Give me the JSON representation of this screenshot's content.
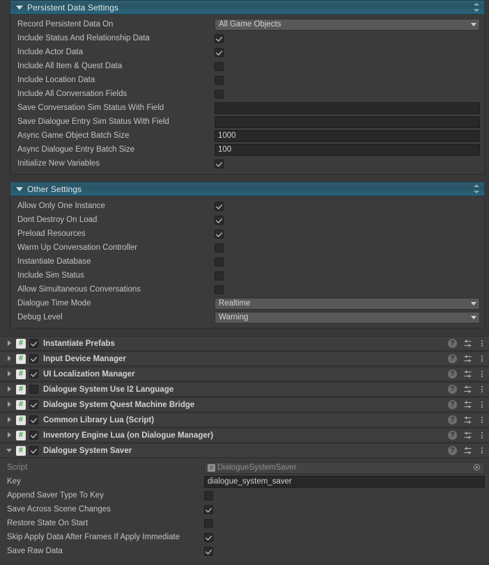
{
  "sections": [
    {
      "id": "persistent-data-settings",
      "title": "Persistent Data Settings",
      "expanded": true,
      "rows": [
        {
          "label": "Record Persistent Data On",
          "type": "dropdown",
          "value": "All Game Objects"
        },
        {
          "label": "Include Status And Relationship Data",
          "type": "checkbox",
          "checked": true
        },
        {
          "label": "Include Actor Data",
          "type": "checkbox",
          "checked": true
        },
        {
          "label": "Include All Item & Quest Data",
          "type": "checkbox",
          "checked": false
        },
        {
          "label": "Include Location Data",
          "type": "checkbox",
          "checked": false
        },
        {
          "label": "Include All Conversation Fields",
          "type": "checkbox",
          "checked": false
        },
        {
          "label": "Save Conversation Sim Status With Field",
          "type": "text",
          "value": ""
        },
        {
          "label": "Save Dialogue Entry Sim Status With Field",
          "type": "text",
          "value": ""
        },
        {
          "label": "Async Game Object Batch Size",
          "type": "text",
          "value": "1000"
        },
        {
          "label": "Async Dialogue Entry Batch Size",
          "type": "text",
          "value": "100"
        },
        {
          "label": "Initialize New Variables",
          "type": "checkbox",
          "checked": true
        }
      ]
    },
    {
      "id": "other-settings",
      "title": "Other Settings",
      "expanded": true,
      "rows": [
        {
          "label": "Allow Only One Instance",
          "type": "checkbox",
          "checked": true
        },
        {
          "label": "Dont Destroy On Load",
          "type": "checkbox",
          "checked": true
        },
        {
          "label": "Preload Resources",
          "type": "checkbox",
          "checked": true
        },
        {
          "label": "Warm Up Conversation Controller",
          "type": "checkbox",
          "checked": false
        },
        {
          "label": "Instantiate Database",
          "type": "checkbox",
          "checked": false
        },
        {
          "label": "Include Sim Status",
          "type": "checkbox",
          "checked": false
        },
        {
          "label": "Allow Simultaneous Conversations",
          "type": "checkbox",
          "checked": false
        },
        {
          "label": "Dialogue Time Mode",
          "type": "dropdown",
          "value": "Realtime"
        },
        {
          "label": "Debug Level",
          "type": "dropdown",
          "value": "Warning"
        }
      ]
    }
  ],
  "components": [
    {
      "name": "Instantiate Prefabs",
      "enabled": true,
      "expanded": false
    },
    {
      "name": "Input Device Manager",
      "enabled": true,
      "expanded": false
    },
    {
      "name": "UI Localization Manager",
      "enabled": true,
      "expanded": false
    },
    {
      "name": "Dialogue System Use I2 Language",
      "enabled": false,
      "expanded": false
    },
    {
      "name": "Dialogue System Quest Machine Bridge",
      "enabled": true,
      "expanded": false
    },
    {
      "name": "Common Library Lua (Script)",
      "enabled": true,
      "expanded": false
    },
    {
      "name": "Inventory Engine Lua (on Dialogue Manager)",
      "enabled": true,
      "expanded": false
    },
    {
      "name": "Dialogue System Saver",
      "enabled": true,
      "expanded": true,
      "rows": [
        {
          "label": "Script",
          "type": "object",
          "value": "DialogueSystemSaver",
          "disabled": true
        },
        {
          "label": "Key",
          "type": "text",
          "value": "dialogue_system_saver"
        },
        {
          "label": "Append Saver Type To Key",
          "type": "checkbox",
          "checked": false
        },
        {
          "label": "Save Across Scene Changes",
          "type": "checkbox",
          "checked": true
        },
        {
          "label": "Restore State On Start",
          "type": "checkbox",
          "checked": false
        },
        {
          "label": "Skip Apply Data After Frames If Apply Immediate",
          "type": "checkbox",
          "checked": true
        },
        {
          "label": "Save Raw Data",
          "type": "checkbox",
          "checked": true
        }
      ]
    }
  ],
  "icons": {
    "foldout_open": "chevron-down-icon",
    "foldout_closed": "chevron-right-icon",
    "help": "help-icon",
    "preset": "preset-icon",
    "menu": "kebab-menu-icon",
    "script": "script-icon",
    "sort": "sort-handle-icon",
    "picker": "object-picker-icon"
  },
  "colors": {
    "window_bg": "#383838",
    "box_bg": "#3b3b3b",
    "header_teal": "#2a5365",
    "row_bg": "#3e3e3e",
    "field_dark": "#282828",
    "dropdown_gray": "#585858",
    "text": "#c4c4c4",
    "script_green": "#3f9e3f"
  }
}
